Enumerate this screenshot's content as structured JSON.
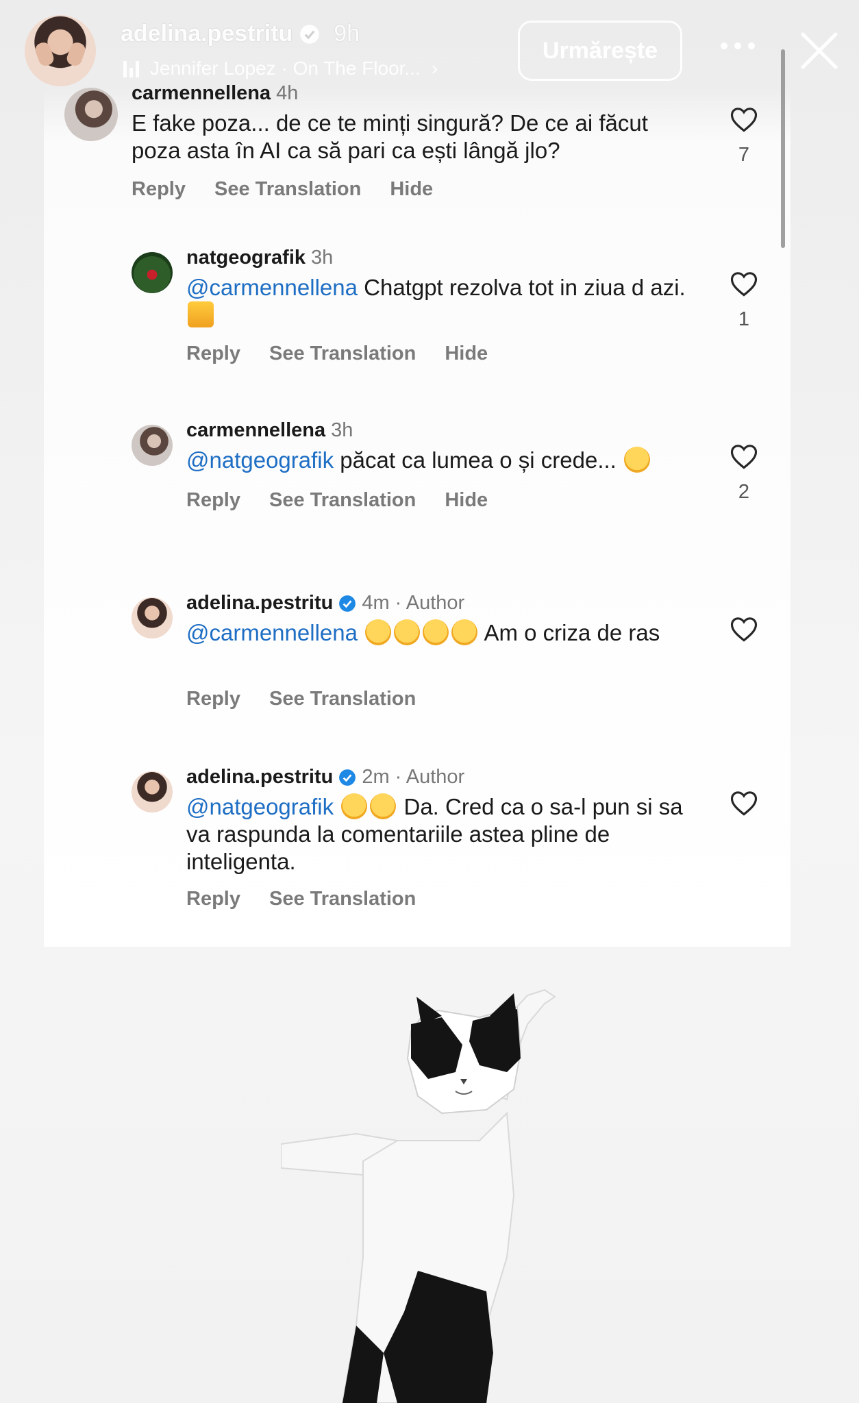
{
  "story": {
    "username": "adelina.pestritu",
    "time": "9h",
    "music": "Jennifer Lopez · On The Floor...",
    "follow_label": "Urmărește"
  },
  "comments": [
    {
      "username": "carmennellena",
      "time": "4h",
      "text": "E fake poza... de ce te minți singură? De ce ai făcut poza asta în AI ca să pari ca ești lângă jlo?",
      "actions": [
        "Reply",
        "See Translation",
        "Hide"
      ],
      "likes": "7"
    },
    {
      "username": "natgeografik",
      "time": "3h",
      "mention": "@carmennellena",
      "text": " Chatgpt rezolva tot in ziua d azi.",
      "actions": [
        "Reply",
        "See Translation",
        "Hide"
      ],
      "likes": "1"
    },
    {
      "username": "carmennellena",
      "time": "3h",
      "mention": "@natgeografik",
      "text": " păcat ca lumea o și crede...",
      "actions": [
        "Reply",
        "See Translation",
        "Hide"
      ],
      "likes": "2"
    },
    {
      "username": "adelina.pestritu",
      "time": "4m",
      "author_label": "· Author",
      "mention": "@carmennellena",
      "text": " Am o criza de ras",
      "actions": [
        "Reply",
        "See Translation"
      ]
    },
    {
      "username": "adelina.pestritu",
      "time": "2m",
      "author_label": "· Author",
      "mention": "@natgeografik",
      "text": " Da. Cred ca  o sa-l pun si sa va raspunda la comentariile astea pline de inteligenta.",
      "actions": [
        "Reply",
        "See Translation"
      ]
    }
  ],
  "colors": {
    "mention": "#1e6ec4",
    "verified": "#1e88e5",
    "action": "#7a7a7a"
  }
}
